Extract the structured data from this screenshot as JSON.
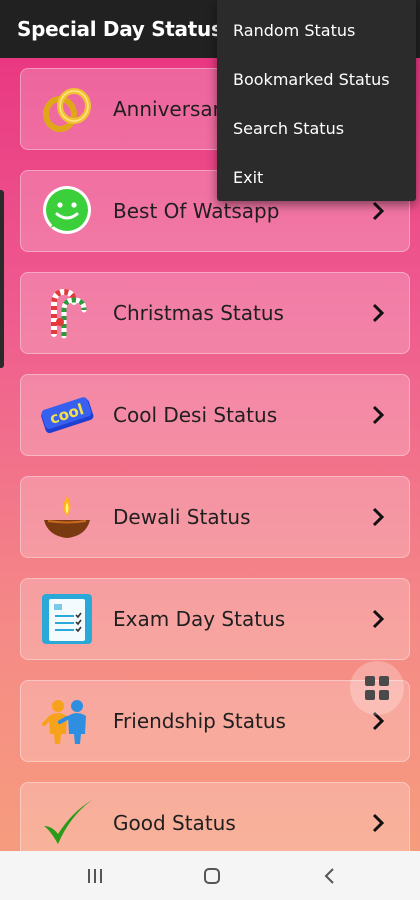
{
  "app": {
    "title": "Special Day Status"
  },
  "items": [
    {
      "label": "Anniversary Status",
      "icon": "wedding-rings-icon"
    },
    {
      "label": "Best Of Watsapp",
      "icon": "smiley-chat-icon"
    },
    {
      "label": "Christmas Status",
      "icon": "candy-cane-icon"
    },
    {
      "label": "Cool Desi Status",
      "icon": "cool-text-icon"
    },
    {
      "label": "Dewali Status",
      "icon": "diya-lamp-icon"
    },
    {
      "label": "Exam Day Status",
      "icon": "checklist-icon"
    },
    {
      "label": "Friendship Status",
      "icon": "friends-icon"
    },
    {
      "label": "Good Status",
      "icon": "checkmark-icon"
    }
  ],
  "menu": {
    "items": [
      {
        "label": "Random Status"
      },
      {
        "label": "Bookmarked Status"
      },
      {
        "label": "Search Status"
      },
      {
        "label": "Exit"
      }
    ]
  },
  "colors": {
    "appbar": "#212121",
    "gradient_top": "#e8307f",
    "gradient_bottom": "#f7a07c",
    "menu_bg": "#2b2b2b"
  }
}
